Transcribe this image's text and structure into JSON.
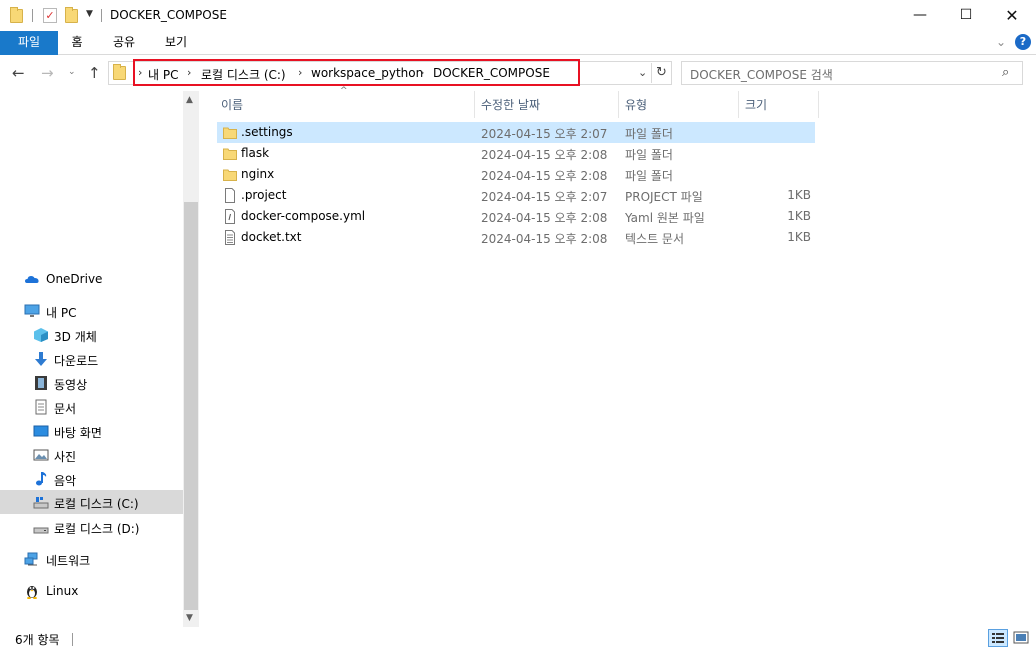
{
  "window": {
    "title": "DOCKER_COMPOSE"
  },
  "ribbon": {
    "tabs": [
      "파일",
      "홈",
      "공유",
      "보기"
    ]
  },
  "address": {
    "crumbs": [
      "내 PC",
      "로컬 디스크 (C:)",
      "workspace_python",
      "DOCKER_COMPOSE"
    ],
    "highlight_color": "#e81123"
  },
  "search": {
    "placeholder": "DOCKER_COMPOSE 검색"
  },
  "nav": {
    "items": [
      {
        "label": "OneDrive",
        "icon": "cloud-icon"
      },
      {
        "label": "내 PC",
        "icon": "computer-icon"
      },
      {
        "label": "3D 개체",
        "icon": "cube-icon"
      },
      {
        "label": "다운로드",
        "icon": "download-arrow-icon"
      },
      {
        "label": "동영상",
        "icon": "film-icon"
      },
      {
        "label": "문서",
        "icon": "document-icon"
      },
      {
        "label": "바탕 화면",
        "icon": "desktop-icon"
      },
      {
        "label": "사진",
        "icon": "picture-icon"
      },
      {
        "label": "음악",
        "icon": "music-note-icon"
      },
      {
        "label": "로컬 디스크 (C:)",
        "icon": "drive-icon",
        "selected": true
      },
      {
        "label": "로컬 디스크 (D:)",
        "icon": "drive-icon"
      },
      {
        "label": "네트워크",
        "icon": "network-icon"
      },
      {
        "label": "Linux",
        "icon": "penguin-icon"
      }
    ]
  },
  "columns": {
    "name": "이름",
    "date": "수정한 날짜",
    "type": "유형",
    "size": "크기"
  },
  "files": [
    {
      "name": ".settings",
      "date": "2024-04-15 오후 2:07",
      "type": "파일 폴더",
      "size": "",
      "icon": "folder-icon",
      "selected": true
    },
    {
      "name": "flask",
      "date": "2024-04-15 오후 2:08",
      "type": "파일 폴더",
      "size": "",
      "icon": "folder-icon"
    },
    {
      "name": "nginx",
      "date": "2024-04-15 오후 2:08",
      "type": "파일 폴더",
      "size": "",
      "icon": "folder-icon"
    },
    {
      "name": ".project",
      "date": "2024-04-15 오후 2:07",
      "type": "PROJECT 파일",
      "size": "1KB",
      "icon": "blank-file-icon"
    },
    {
      "name": "docker-compose.yml",
      "date": "2024-04-15 오후 2:08",
      "type": "Yaml 원본 파일",
      "size": "1KB",
      "icon": "yaml-file-icon"
    },
    {
      "name": "docket.txt",
      "date": "2024-04-15 오후 2:08",
      "type": "텍스트 문서",
      "size": "1KB",
      "icon": "text-file-icon"
    }
  ],
  "status": {
    "count": "6개 항목"
  },
  "colors": {
    "accent": "#1979ca",
    "selection": "#cce8ff",
    "folder": "#f8d876"
  }
}
